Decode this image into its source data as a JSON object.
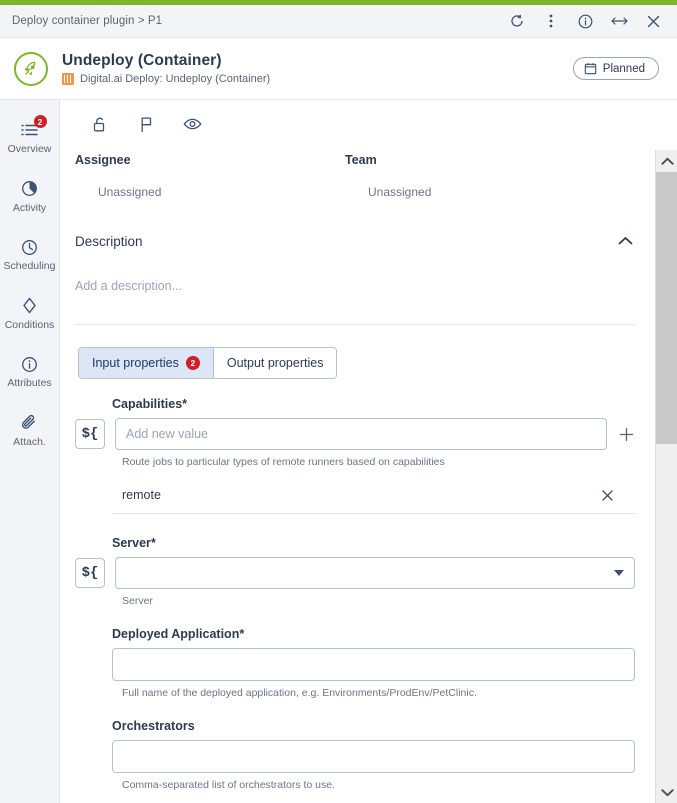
{
  "theme": {
    "accent_green": "#7eb52b",
    "badge_red": "#cf2027",
    "tab_active_bg": "#dde6f5",
    "text_dark": "#2e3a4d",
    "text_muted": "#6b7587",
    "plugin_orange": "#f0954a"
  },
  "chrome": {
    "breadcrumb": "Deploy container plugin > P1",
    "actions": [
      {
        "name": "refresh-button",
        "label": "Refresh"
      },
      {
        "name": "more-options-button",
        "label": "More options"
      },
      {
        "name": "info-button",
        "label": "Info"
      },
      {
        "name": "resize-button",
        "label": "Resize"
      },
      {
        "name": "close-button",
        "label": "Close"
      }
    ]
  },
  "header": {
    "logo_icon": "rocket-icon",
    "title": "Undeploy (Container)",
    "plugin_icon": "plugin-bars-icon",
    "subtitle": "Digital.ai Deploy: Undeploy (Container)",
    "status": {
      "icon": "calendar-icon",
      "label": "Planned"
    }
  },
  "sidebar": {
    "items": [
      {
        "label": "Overview",
        "icon": "list-icon",
        "badge": "2"
      },
      {
        "label": "Activity",
        "icon": "pie-chart-icon",
        "badge": ""
      },
      {
        "label": "Scheduling",
        "icon": "clock-icon",
        "badge": ""
      },
      {
        "label": "Conditions",
        "icon": "diamond-icon",
        "badge": ""
      },
      {
        "label": "Attributes",
        "icon": "info-icon",
        "badge": ""
      },
      {
        "label": "Attach.",
        "icon": "paperclip-icon",
        "badge": ""
      }
    ]
  },
  "toolbar": {
    "items": [
      {
        "name": "lock-toggle",
        "icon": "unlock-icon"
      },
      {
        "name": "flag-toggle",
        "icon": "flag-icon"
      },
      {
        "name": "visibility-toggle",
        "icon": "eye-icon"
      }
    ]
  },
  "assignment": {
    "assignee_label": "Assignee",
    "assignee_value": "Unassigned",
    "team_label": "Team",
    "team_value": "Unassigned"
  },
  "description": {
    "title": "Description",
    "collapse_icon": "chevron-up-icon",
    "placeholder": "Add a description..."
  },
  "tabs": [
    {
      "label": "Input properties",
      "badge": "2",
      "active": true
    },
    {
      "label": "Output properties",
      "badge": "",
      "active": false
    }
  ],
  "form": {
    "expression_button_label": "${",
    "fields": [
      {
        "label": "Capabilities",
        "required_mark": "*",
        "placeholder": "Add new value",
        "value": "",
        "hint": "Route jobs to particular types of remote runners based on capabilities",
        "add_icon": "plus-icon",
        "chips": [
          {
            "label": "remote",
            "remove_icon": "close-icon"
          }
        ]
      },
      {
        "label": "Server",
        "required_mark": "*",
        "placeholder": "",
        "value": "",
        "hint": "Server",
        "dropdown_icon": "chevron-down-icon"
      },
      {
        "label": "Deployed Application",
        "required_mark": "*",
        "placeholder": "",
        "value": "",
        "hint": "Full name of the deployed application, e.g. Environments/ProdEnv/PetClinic."
      },
      {
        "label": "Orchestrators",
        "required_mark": "",
        "placeholder": "",
        "value": "",
        "hint": "Comma-separated list of orchestrators to use."
      }
    ]
  },
  "scrollbar": {
    "up_icon": "chevron-up-icon",
    "down_icon": "chevron-down-icon"
  }
}
